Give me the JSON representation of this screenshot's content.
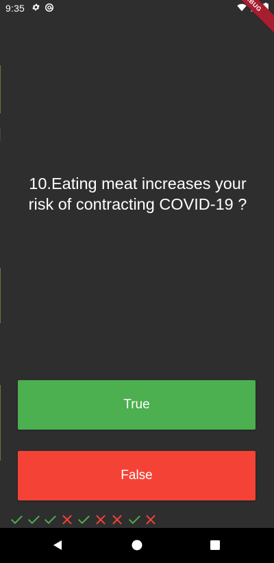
{
  "status_bar": {
    "time": "9:35",
    "left_icons": [
      "gear-icon",
      "at-sync-icon"
    ],
    "right_icons": [
      "wifi-icon",
      "signal-icon",
      "battery-icon"
    ],
    "debug_label": "DEBUG"
  },
  "quiz": {
    "question": "10.Eating meat increases your risk of contracting COVID-19 ?",
    "true_label": "True",
    "false_label": "False",
    "true_color": "#4caf50",
    "false_color": "#f44336",
    "score_keeper": [
      {
        "result": "correct",
        "icon": "check-icon"
      },
      {
        "result": "correct",
        "icon": "check-icon"
      },
      {
        "result": "correct",
        "icon": "check-icon"
      },
      {
        "result": "wrong",
        "icon": "close-icon"
      },
      {
        "result": "correct",
        "icon": "check-icon"
      },
      {
        "result": "wrong",
        "icon": "close-icon"
      },
      {
        "result": "wrong",
        "icon": "close-icon"
      },
      {
        "result": "correct",
        "icon": "check-icon"
      },
      {
        "result": "wrong",
        "icon": "close-icon"
      }
    ],
    "correct_color": "#4caf50",
    "wrong_color": "#f44336"
  },
  "nav_bar": {
    "buttons": [
      "back-icon",
      "home-icon",
      "recents-icon"
    ]
  }
}
